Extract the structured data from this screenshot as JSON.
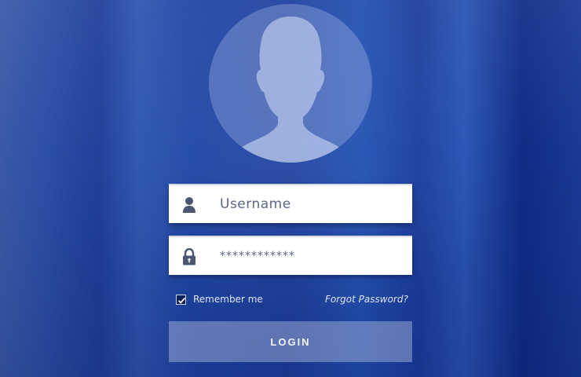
{
  "avatar": {
    "icon": "user-silhouette-icon"
  },
  "username_field": {
    "placeholder": "Username",
    "icon": "user-icon"
  },
  "password_field": {
    "value": "************",
    "icon": "lock-icon"
  },
  "remember_me": {
    "label": "Remember me",
    "checked": true
  },
  "forgot_password": {
    "label": "Forgot Password?"
  },
  "login_button": {
    "label": "LOGIN"
  },
  "colors": {
    "background": "#1f3f99",
    "field_text": "#5a6785",
    "icon": "#4a5570",
    "label_text": "#dde4f7"
  }
}
